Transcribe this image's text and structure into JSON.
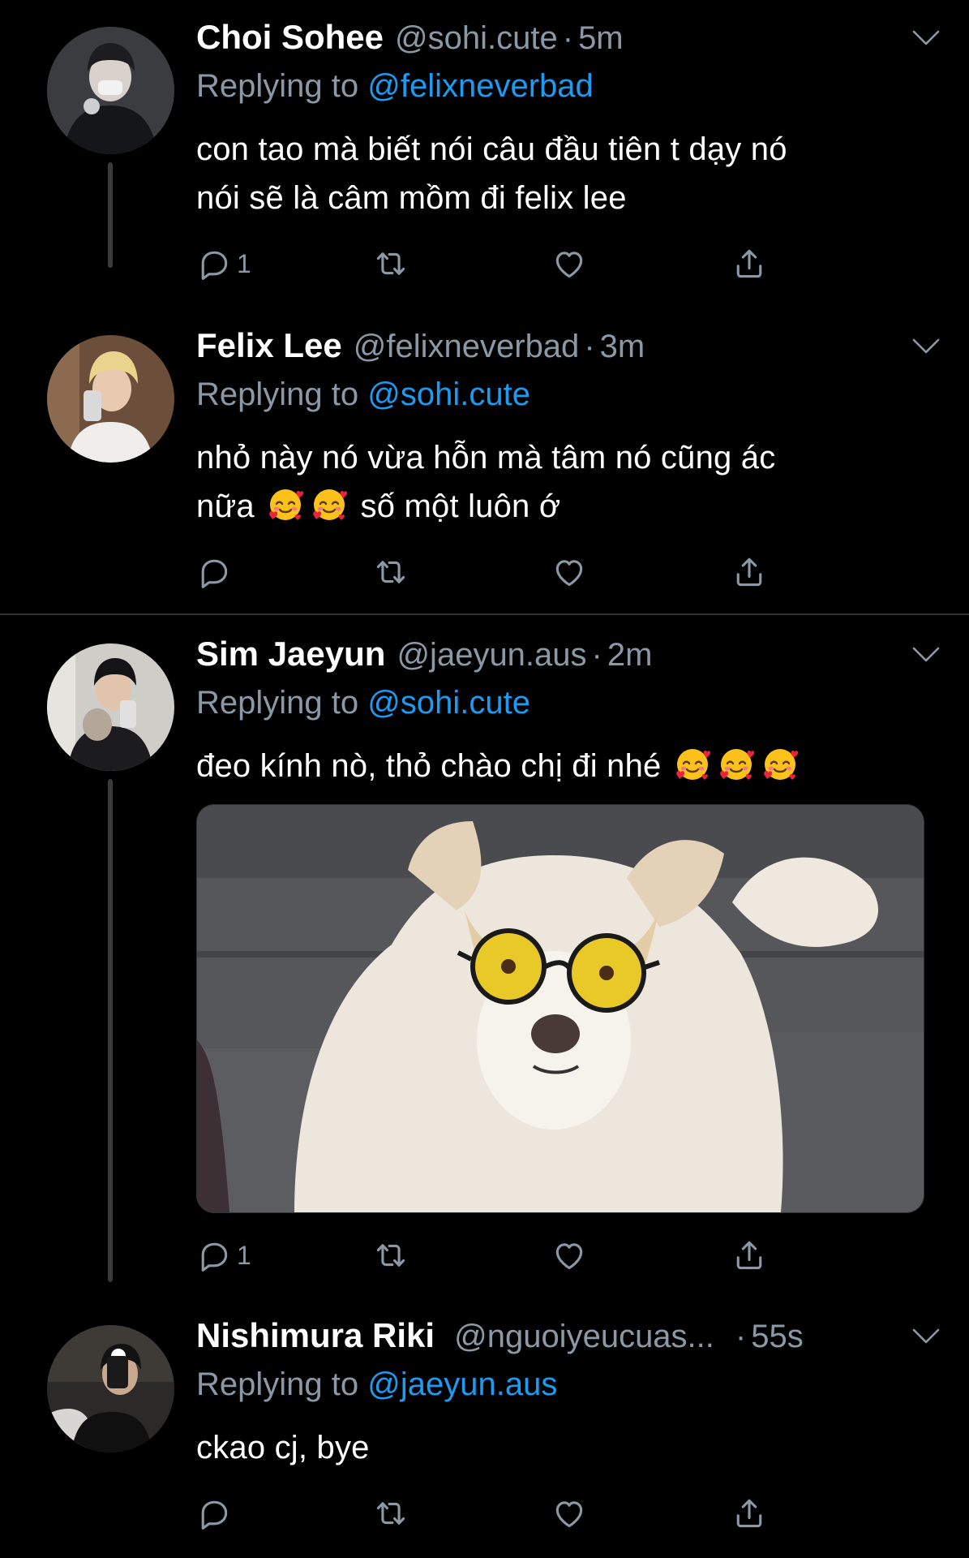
{
  "tweets": [
    {
      "name": "Choi Sohee",
      "handle": "@sohi.cute",
      "time": "5m",
      "replying_prefix": "Replying to",
      "replying_to": "@felixneverbad",
      "text_line1": "con tao mà biết nói câu đầu tiên t dạy nó",
      "text_line2": "nói sẽ là câm mồm đi felix lee",
      "reply_count": "1"
    },
    {
      "name": "Felix Lee",
      "handle": "@felixneverbad",
      "time": "3m",
      "replying_prefix": "Replying to",
      "replying_to": "@sohi.cute",
      "text_line1": "nhỏ này nó vừa hỗn mà tâm nó cũng ác",
      "text_line2_a": "nữa",
      "text_line2_b": "số một luôn ớ",
      "reply_count": ""
    },
    {
      "name": "Sim Jaeyun",
      "handle": "@jaeyun.aus",
      "time": "2m",
      "replying_prefix": "Replying to",
      "replying_to": "@sohi.cute",
      "text_line1": "đeo kính nò, thỏ chào chị đi nhé",
      "reply_count": "1"
    },
    {
      "name": "Nishimura Riki",
      "handle": "@nguoiyeucuas...",
      "time": "55s",
      "replying_prefix": "Replying to",
      "replying_to": "@jaeyun.aus",
      "text_line1": "ckao cj, bye",
      "reply_count": ""
    }
  ],
  "icons": {
    "reply": "reply-icon",
    "retweet": "retweet-icon",
    "like": "heart-icon",
    "share": "share-icon",
    "more": "chevron-down-icon",
    "emoji": "smiling-face-with-hearts-emoji"
  },
  "colors": {
    "background": "#000000",
    "secondary_text": "#8b98a5",
    "mention": "#1d9bf0",
    "divider": "#2f3336"
  }
}
